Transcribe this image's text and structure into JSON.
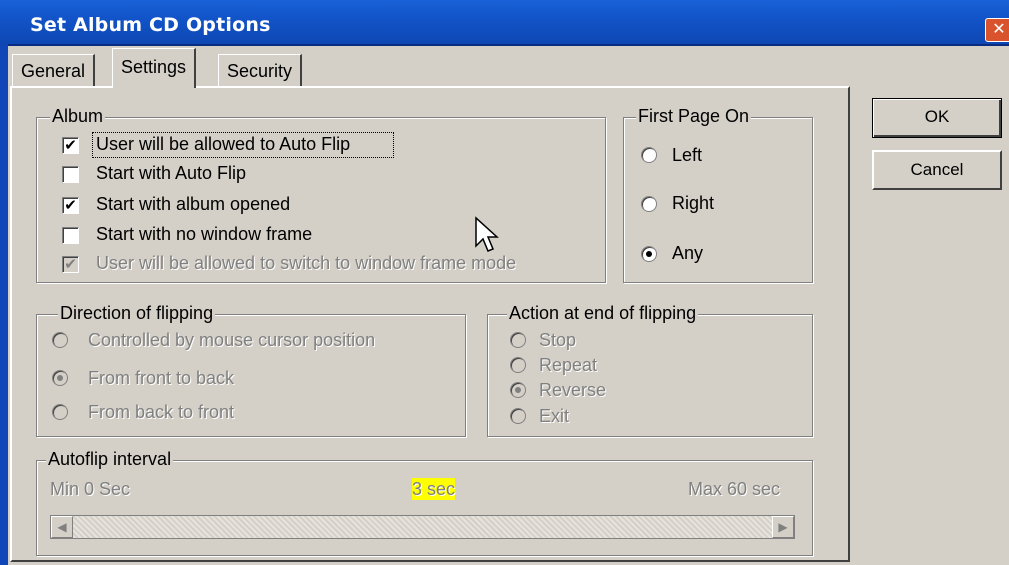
{
  "window": {
    "title": "Set Album CD Options",
    "close_glyph": "✕"
  },
  "tabs": [
    {
      "label": "General"
    },
    {
      "label": "Settings",
      "active": true
    },
    {
      "label": "Security"
    }
  ],
  "album": {
    "legend": "Album",
    "options": [
      {
        "label": "User will be allowed to Auto Flip",
        "checked": true,
        "enabled": true
      },
      {
        "label": "Start with Auto Flip",
        "checked": false,
        "enabled": true
      },
      {
        "label": "Start with album opened",
        "checked": true,
        "enabled": true
      },
      {
        "label": "Start with no window frame",
        "checked": false,
        "enabled": true
      },
      {
        "label": "User will be allowed to switch to window frame mode",
        "checked": true,
        "enabled": false
      }
    ]
  },
  "first_page": {
    "legend": "First Page On",
    "options": [
      {
        "label": "Left",
        "selected": false
      },
      {
        "label": "Right",
        "selected": false
      },
      {
        "label": "Any",
        "selected": true
      }
    ]
  },
  "direction": {
    "legend": "Direction of flipping",
    "options": [
      {
        "label": "Controlled by mouse cursor position",
        "selected": false
      },
      {
        "label": "From front to back",
        "selected": true
      },
      {
        "label": "From back to front",
        "selected": false
      }
    ]
  },
  "end_action": {
    "legend": "Action at end of flipping",
    "options": [
      {
        "label": "Stop",
        "selected": false
      },
      {
        "label": "Repeat",
        "selected": false
      },
      {
        "label": "Reverse",
        "selected": true
      },
      {
        "label": "Exit",
        "selected": false
      }
    ]
  },
  "autoflip": {
    "legend": "Autoflip interval",
    "min_label": "Min 0 Sec",
    "current_label": "3 sec",
    "max_label": "Max 60 sec",
    "highlight_color": "#ffff00",
    "scroll_position_fraction": 0.05
  },
  "buttons": {
    "ok": "OK",
    "cancel": "Cancel"
  },
  "colors": {
    "titlebar": "#1254c9",
    "dialog_bg": "#d4d0c8",
    "disabled_text": "#808080"
  }
}
